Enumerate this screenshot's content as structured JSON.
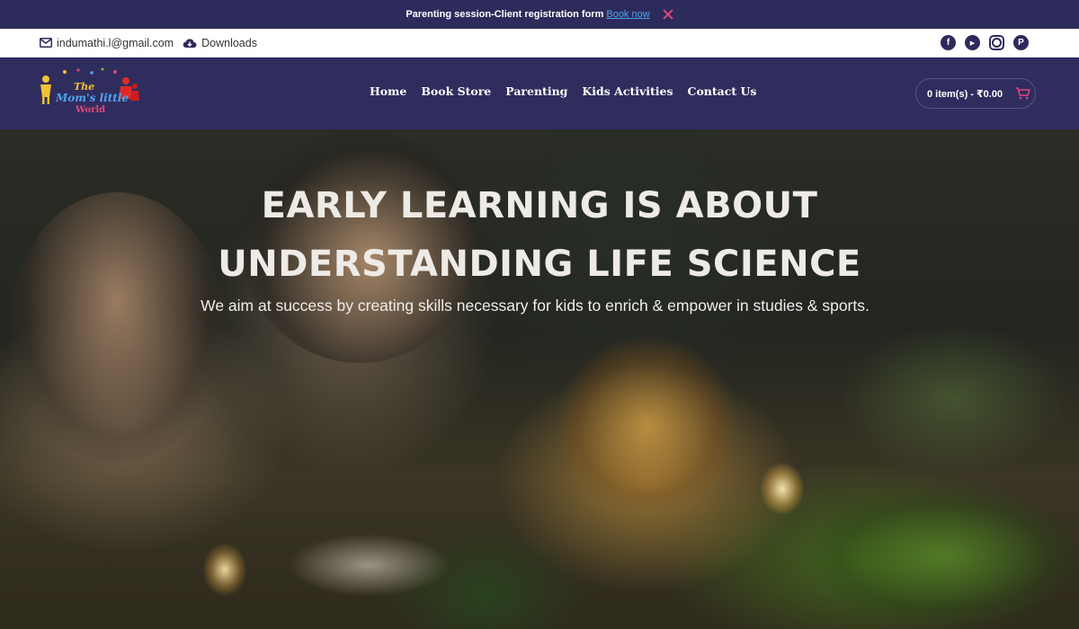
{
  "announcement": {
    "text": "Parenting session-Client registration form",
    "link_label": "Book now"
  },
  "contact": {
    "email": "indumathi.l@gmail.com",
    "downloads_label": "Downloads"
  },
  "social": {
    "icons": [
      "facebook-icon",
      "youtube-icon",
      "instagram-icon",
      "pinterest-icon"
    ],
    "facebook_glyph": "f",
    "youtube_glyph": "▶",
    "pinterest_glyph": "P"
  },
  "logo": {
    "line1": "The",
    "line2": "Mom's little",
    "line3": "World"
  },
  "nav": {
    "home": "Home",
    "book_store": "Book Store",
    "parenting": "Parenting",
    "kids_activities": "Kids Activities",
    "contact_us": "Contact Us"
  },
  "cart": {
    "label": "0 item(s) - ₹0.00"
  },
  "hero": {
    "heading_line1": "EARLY LEARNING IS ABOUT",
    "heading_line2": "UNDERSTANDING LIFE SCIENCE",
    "subheading": "We aim at success by creating skills necessary for kids to enrich & empower in studies & sports."
  },
  "colors": {
    "header_bg": "#2f2d5e",
    "link_blue": "#4ea3f0",
    "close_pink": "#e0467a",
    "cart_pink": "#e0467a"
  }
}
